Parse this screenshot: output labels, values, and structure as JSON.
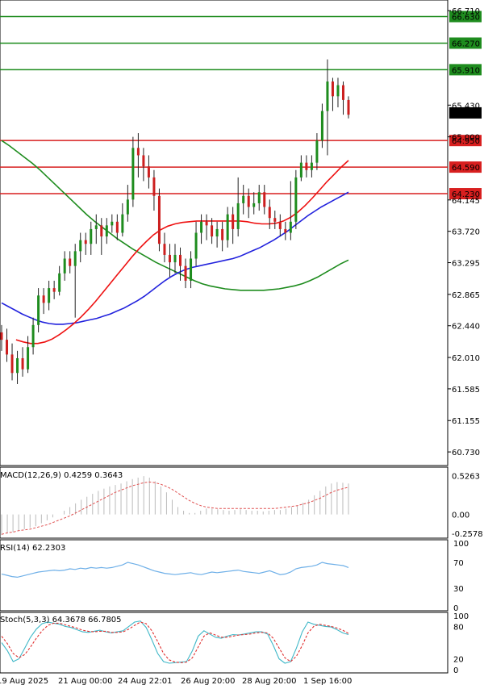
{
  "chart_data": {
    "type": "candlestick",
    "main_panel": {
      "y_ticks": [
        "66.710",
        "65.430",
        "65.000",
        "64.145",
        "63.720",
        "63.295",
        "62.865",
        "62.440",
        "62.010",
        "61.585",
        "61.155",
        "60.730"
      ],
      "ylim": [
        60.6,
        66.8
      ],
      "current_price": "65.325",
      "levels": [
        {
          "value": 66.63,
          "label": "66.630",
          "color": "#1e8c1e"
        },
        {
          "value": 66.27,
          "label": "66.270",
          "color": "#1e8c1e"
        },
        {
          "value": 65.91,
          "label": "65.910",
          "color": "#1e8c1e"
        },
        {
          "value": 64.95,
          "label": "64.950",
          "color": "#d81f1f"
        },
        {
          "value": 64.59,
          "label": "64.590",
          "color": "#d81f1f"
        },
        {
          "value": 64.23,
          "label": "64.230",
          "color": "#d81f1f"
        }
      ],
      "candles": [
        [
          62.35,
          62.25,
          62.45,
          62.1
        ],
        [
          62.25,
          62.05,
          62.4,
          61.95
        ],
        [
          62.05,
          61.8,
          62.2,
          61.7
        ],
        [
          61.8,
          62.0,
          62.1,
          61.65
        ],
        [
          62.0,
          61.85,
          62.15,
          61.75
        ],
        [
          61.85,
          62.15,
          62.3,
          61.8
        ],
        [
          62.15,
          62.45,
          62.55,
          62.05
        ],
        [
          62.45,
          62.85,
          62.95,
          62.35
        ],
        [
          62.85,
          62.75,
          62.95,
          62.6
        ],
        [
          62.75,
          62.95,
          63.05,
          62.65
        ],
        [
          62.95,
          62.9,
          63.05,
          62.8
        ],
        [
          62.9,
          63.15,
          63.25,
          62.85
        ],
        [
          63.15,
          63.35,
          63.45,
          63.05
        ],
        [
          63.35,
          63.25,
          63.45,
          63.15
        ],
        [
          63.25,
          63.45,
          63.55,
          62.55
        ],
        [
          63.45,
          63.6,
          63.7,
          63.3
        ],
        [
          63.6,
          63.55,
          63.7,
          63.4
        ],
        [
          63.55,
          63.75,
          63.85,
          63.4
        ],
        [
          63.75,
          63.8,
          63.95,
          63.55
        ],
        [
          63.8,
          63.65,
          63.9,
          63.4
        ],
        [
          63.65,
          63.8,
          63.9,
          63.55
        ],
        [
          63.8,
          63.85,
          63.95,
          63.7
        ],
        [
          63.85,
          63.7,
          63.95,
          63.6
        ],
        [
          63.7,
          63.95,
          64.1,
          63.65
        ],
        [
          63.95,
          64.15,
          64.35,
          63.85
        ],
        [
          64.15,
          64.85,
          65.0,
          64.05
        ],
        [
          64.85,
          64.75,
          65.05,
          64.45
        ],
        [
          64.75,
          64.6,
          64.85,
          64.4
        ],
        [
          64.6,
          64.45,
          64.75,
          64.3
        ],
        [
          64.45,
          64.2,
          64.55,
          64.0
        ],
        [
          64.2,
          63.55,
          64.3,
          63.45
        ],
        [
          63.55,
          63.4,
          63.7,
          63.3
        ],
        [
          63.4,
          63.3,
          63.55,
          63.1
        ],
        [
          63.3,
          63.4,
          63.55,
          63.15
        ],
        [
          63.4,
          63.25,
          63.5,
          63.05
        ],
        [
          63.25,
          63.05,
          63.35,
          62.95
        ],
        [
          63.05,
          63.35,
          63.45,
          62.95
        ],
        [
          63.35,
          63.7,
          63.85,
          63.25
        ],
        [
          63.7,
          63.85,
          63.95,
          63.55
        ],
        [
          63.85,
          63.8,
          63.95,
          63.6
        ],
        [
          63.8,
          63.65,
          63.9,
          63.55
        ],
        [
          63.65,
          63.75,
          63.85,
          63.5
        ],
        [
          63.75,
          63.6,
          63.85,
          63.45
        ],
        [
          63.6,
          63.95,
          64.05,
          63.5
        ],
        [
          63.95,
          63.75,
          64.05,
          63.55
        ],
        [
          63.75,
          64.1,
          64.45,
          63.65
        ],
        [
          64.1,
          64.2,
          64.35,
          63.95
        ],
        [
          64.2,
          64.05,
          64.3,
          63.9
        ],
        [
          64.05,
          64.1,
          64.25,
          63.95
        ],
        [
          64.1,
          64.25,
          64.35,
          64.0
        ],
        [
          64.25,
          64.05,
          64.35,
          63.95
        ],
        [
          64.05,
          63.9,
          64.15,
          63.75
        ],
        [
          63.9,
          63.85,
          64.0,
          63.75
        ],
        [
          63.85,
          63.75,
          63.95,
          63.65
        ],
        [
          63.75,
          63.7,
          63.85,
          63.6
        ],
        [
          63.7,
          63.85,
          64.4,
          63.6
        ],
        [
          63.85,
          64.45,
          64.55,
          63.75
        ],
        [
          64.45,
          64.65,
          64.75,
          64.4
        ],
        [
          64.65,
          64.55,
          64.75,
          64.45
        ],
        [
          64.55,
          64.65,
          64.75,
          64.45
        ],
        [
          64.65,
          64.95,
          65.05,
          64.55
        ],
        [
          64.95,
          65.35,
          65.45,
          64.85
        ],
        [
          65.35,
          65.75,
          66.05,
          64.75
        ],
        [
          65.75,
          65.55,
          65.8,
          65.35
        ],
        [
          65.55,
          65.7,
          65.8,
          65.4
        ],
        [
          65.7,
          65.5,
          65.75,
          65.3
        ],
        [
          65.5,
          65.3,
          65.55,
          65.25
        ]
      ],
      "ma_slow_green": [
        64.95,
        64.88,
        64.8,
        64.72,
        64.64,
        64.55,
        64.45,
        64.35,
        64.25,
        64.15,
        64.05,
        63.95,
        63.86,
        63.78,
        63.7,
        63.62,
        63.55,
        63.48,
        63.42,
        63.36,
        63.3,
        63.25,
        63.2,
        63.15,
        63.1,
        63.05,
        63.01,
        62.98,
        62.96,
        62.94,
        62.93,
        62.92,
        62.92,
        62.92,
        62.92,
        62.93,
        62.94,
        62.96,
        62.98,
        63.01,
        63.05,
        63.1,
        63.16,
        63.22,
        63.28,
        63.33
      ],
      "ma_slow_green_start": 0,
      "ma_mid_blue": [
        62.75,
        62.7,
        62.65,
        62.6,
        62.56,
        62.52,
        62.49,
        62.47,
        62.46,
        62.46,
        62.47,
        62.48,
        62.5,
        62.52,
        62.54,
        62.57,
        62.6,
        62.64,
        62.68,
        62.73,
        62.78,
        62.84,
        62.91,
        62.98,
        63.05,
        63.11,
        63.16,
        63.2,
        63.23,
        63.25,
        63.27,
        63.29,
        63.31,
        63.33,
        63.35,
        63.38,
        63.42,
        63.46,
        63.5,
        63.55,
        63.6,
        63.66,
        63.72,
        63.79,
        63.86,
        63.93,
        63.99,
        64.05,
        64.1,
        64.15,
        64.2,
        64.25
      ],
      "ma_mid_blue_start": 0,
      "ma_fast_red": [
        62.25,
        62.22,
        62.2,
        62.2,
        62.22,
        62.26,
        62.32,
        62.39,
        62.47,
        62.56,
        62.66,
        62.77,
        62.89,
        63.01,
        63.13,
        63.25,
        63.37,
        63.48,
        63.58,
        63.67,
        63.74,
        63.79,
        63.82,
        63.84,
        63.85,
        63.86,
        63.86,
        63.86,
        63.86,
        63.86,
        63.86,
        63.86,
        63.85,
        63.83,
        63.82,
        63.82,
        63.83,
        63.86,
        63.91,
        63.98,
        64.07,
        64.17,
        64.28,
        64.39,
        64.49,
        64.59,
        64.68
      ],
      "ma_fast_red_start": 2
    },
    "macd": {
      "label": "MACD(12,26,9) 0.4259 0.3643",
      "y_ticks": [
        "0.5263",
        "0.00",
        "-0.2578"
      ],
      "ylim": [
        -0.3,
        0.62
      ],
      "histogram": [
        -0.28,
        -0.26,
        -0.24,
        -0.22,
        -0.2,
        -0.18,
        -0.16,
        -0.12,
        -0.08,
        -0.04,
        0.0,
        0.05,
        0.1,
        0.15,
        0.2,
        0.24,
        0.28,
        0.32,
        0.35,
        0.38,
        0.4,
        0.42,
        0.45,
        0.48,
        0.5,
        0.52,
        0.5,
        0.45,
        0.38,
        0.3,
        0.2,
        0.1,
        0.05,
        0.02,
        0.02,
        0.05,
        0.08,
        0.08,
        0.07,
        0.06,
        0.05,
        0.06,
        0.07,
        0.06,
        0.05,
        0.05,
        0.04,
        0.05,
        0.06,
        0.06,
        0.08,
        0.1,
        0.12,
        0.16,
        0.2,
        0.26,
        0.32,
        0.38,
        0.42,
        0.44,
        0.43,
        0.42
      ],
      "signal": [
        -0.27,
        -0.25,
        -0.24,
        -0.22,
        -0.21,
        -0.2,
        -0.18,
        -0.16,
        -0.14,
        -0.11,
        -0.08,
        -0.05,
        -0.02,
        0.02,
        0.06,
        0.1,
        0.14,
        0.18,
        0.22,
        0.26,
        0.3,
        0.33,
        0.36,
        0.39,
        0.41,
        0.43,
        0.44,
        0.43,
        0.41,
        0.38,
        0.34,
        0.29,
        0.24,
        0.19,
        0.15,
        0.12,
        0.1,
        0.09,
        0.08,
        0.08,
        0.08,
        0.08,
        0.08,
        0.08,
        0.08,
        0.08,
        0.08,
        0.08,
        0.08,
        0.09,
        0.1,
        0.11,
        0.12,
        0.14,
        0.16,
        0.19,
        0.22,
        0.26,
        0.3,
        0.33,
        0.35,
        0.37
      ]
    },
    "rsi": {
      "label": "RSI(14) 62.2303",
      "y_ticks": [
        "100",
        "70",
        "30",
        "0"
      ],
      "ylim": [
        0,
        100
      ],
      "values": [
        52,
        50,
        48,
        47,
        49,
        51,
        53,
        55,
        56,
        57,
        58,
        57,
        58,
        60,
        59,
        61,
        60,
        62,
        61,
        62,
        61,
        62,
        64,
        66,
        70,
        68,
        66,
        63,
        60,
        57,
        55,
        53,
        52,
        51,
        52,
        53,
        54,
        52,
        51,
        53,
        55,
        54,
        55,
        56,
        57,
        58,
        56,
        55,
        54,
        53,
        55,
        57,
        54,
        51,
        52,
        55,
        60,
        62,
        63,
        64,
        66,
        70,
        68,
        67,
        66,
        65,
        62
      ]
    },
    "stoch": {
      "label": "Stoch(5,3,3) 64.3678 66.7805",
      "y_ticks": [
        "100",
        "80",
        "20",
        "0"
      ],
      "ylim": [
        0,
        100
      ],
      "k": [
        50,
        35,
        15,
        20,
        40,
        60,
        75,
        85,
        88,
        86,
        84,
        80,
        78,
        74,
        70,
        69,
        71,
        73,
        70,
        68,
        70,
        72,
        80,
        88,
        90,
        78,
        55,
        30,
        15,
        12,
        13,
        14,
        15,
        35,
        62,
        72,
        66,
        60,
        58,
        62,
        65,
        64,
        66,
        68,
        70,
        70,
        66,
        45,
        20,
        12,
        15,
        40,
        70,
        88,
        84,
        82,
        80,
        79,
        74,
        68,
        65
      ],
      "d": [
        62,
        48,
        30,
        22,
        28,
        42,
        58,
        72,
        82,
        86,
        86,
        83,
        80,
        77,
        73,
        71,
        70,
        71,
        71,
        69,
        69,
        70,
        75,
        82,
        88,
        85,
        72,
        52,
        30,
        18,
        14,
        13,
        14,
        22,
        42,
        62,
        68,
        64,
        60,
        60,
        62,
        64,
        65,
        66,
        68,
        69,
        68,
        58,
        40,
        22,
        15,
        25,
        45,
        68,
        80,
        84,
        82,
        80,
        77,
        73,
        67
      ]
    },
    "x_labels": [
      "19 Aug 2025",
      "21 Aug 00:00",
      "24 Aug 22:01",
      "26 Aug 20:00",
      "28 Aug 20:00",
      "1 Sep 16:00"
    ]
  },
  "colors": {
    "bull": "#1e8c1e",
    "bear": "#cc1f1f",
    "ma_green": "#1e8c1e",
    "ma_blue": "#2222dd",
    "ma_red": "#ee1111",
    "rsi_line": "#6fb0e8",
    "macd_hist": "#bbbbbb",
    "macd_signal": "#e05050",
    "stoch_k": "#40b8c8",
    "stoch_d": "#e03030"
  }
}
